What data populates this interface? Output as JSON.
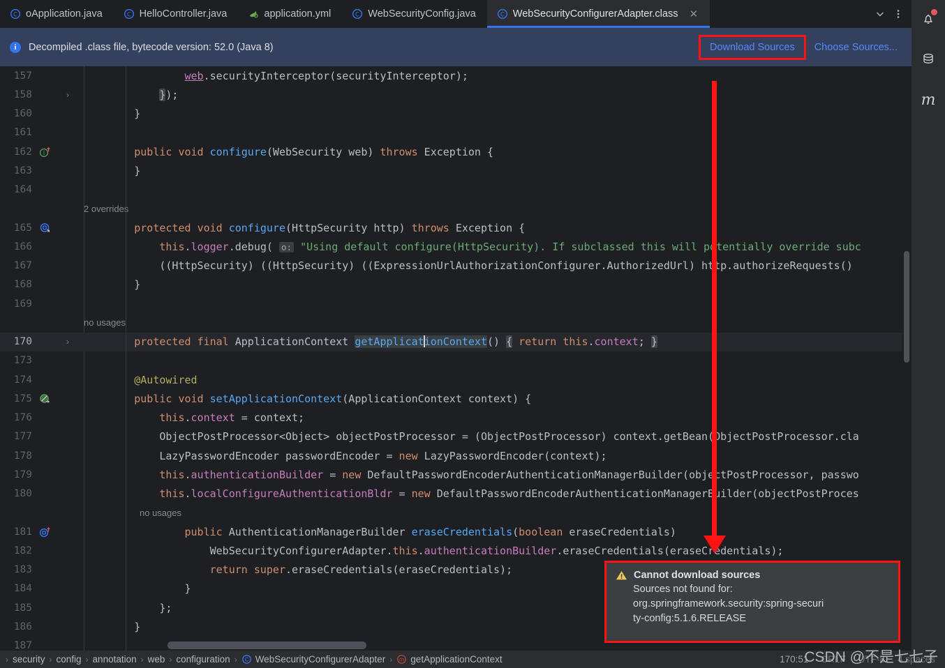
{
  "tabs": [
    {
      "label": "oApplication.java",
      "icon": "java-class-icon",
      "active": false,
      "truncated": true
    },
    {
      "label": "HelloController.java",
      "icon": "java-class-icon",
      "active": false
    },
    {
      "label": "application.yml",
      "icon": "spring-yaml-icon",
      "active": false
    },
    {
      "label": "WebSecurityConfig.java",
      "icon": "java-class-icon",
      "active": false
    },
    {
      "label": "WebSecurityConfigurerAdapter.class",
      "icon": "java-class-icon",
      "active": true,
      "closable": true
    }
  ],
  "tabbar_actions": {
    "dropdown": "⌄",
    "more": "⋮"
  },
  "banner": {
    "message": "Decompiled .class file, bytecode version: 52.0 (Java 8)",
    "info_glyph": "i",
    "actions": [
      {
        "label": "Download Sources",
        "highlighted": true
      },
      {
        "label": "Choose Sources...",
        "highlighted": false
      }
    ]
  },
  "editor": {
    "lines": [
      {
        "num": "157",
        "gutter": "",
        "fold": "",
        "current": false,
        "type": "code"
      },
      {
        "num": "158",
        "gutter": "",
        "fold": "›",
        "current": false,
        "type": "code"
      },
      {
        "num": "160",
        "gutter": "",
        "fold": "",
        "current": false,
        "type": "code"
      },
      {
        "num": "161",
        "gutter": "",
        "fold": "",
        "current": false,
        "type": "code"
      },
      {
        "num": "162",
        "gutter": "implements-override-icon",
        "fold": "",
        "current": false,
        "type": "code"
      },
      {
        "num": "163",
        "gutter": "",
        "fold": "",
        "current": false,
        "type": "code"
      },
      {
        "num": "164",
        "gutter": "",
        "fold": "",
        "current": false,
        "type": "code"
      },
      {
        "num": "",
        "gutter": "",
        "fold": "",
        "current": false,
        "type": "hint",
        "hint": "2 overrides"
      },
      {
        "num": "165",
        "gutter": "overridden-method-icon",
        "fold": "",
        "current": false,
        "type": "code"
      },
      {
        "num": "166",
        "gutter": "",
        "fold": "",
        "current": false,
        "type": "code"
      },
      {
        "num": "167",
        "gutter": "",
        "fold": "",
        "current": false,
        "type": "code"
      },
      {
        "num": "168",
        "gutter": "",
        "fold": "",
        "current": false,
        "type": "code"
      },
      {
        "num": "169",
        "gutter": "",
        "fold": "",
        "current": false,
        "type": "code"
      },
      {
        "num": "",
        "gutter": "",
        "fold": "",
        "current": false,
        "type": "hint",
        "hint": "no usages"
      },
      {
        "num": "170",
        "gutter": "",
        "fold": "›",
        "current": true,
        "type": "code"
      },
      {
        "num": "173",
        "gutter": "",
        "fold": "",
        "current": false,
        "type": "code"
      },
      {
        "num": "174",
        "gutter": "",
        "fold": "",
        "current": false,
        "type": "code"
      },
      {
        "num": "175",
        "gutter": "no-usage-green-icon",
        "fold": "",
        "current": false,
        "type": "code"
      },
      {
        "num": "176",
        "gutter": "",
        "fold": "",
        "current": false,
        "type": "code"
      },
      {
        "num": "177",
        "gutter": "",
        "fold": "",
        "current": false,
        "type": "code"
      },
      {
        "num": "178",
        "gutter": "",
        "fold": "",
        "current": false,
        "type": "code"
      },
      {
        "num": "179",
        "gutter": "",
        "fold": "",
        "current": false,
        "type": "code"
      },
      {
        "num": "180",
        "gutter": "",
        "fold": "",
        "current": false,
        "type": "code"
      },
      {
        "num": "",
        "gutter": "",
        "fold": "",
        "current": false,
        "type": "hint",
        "hint": "no usages"
      },
      {
        "num": "181",
        "gutter": "overriding-method-icon",
        "fold": "",
        "current": false,
        "type": "code"
      },
      {
        "num": "182",
        "gutter": "",
        "fold": "",
        "current": false,
        "type": "code"
      },
      {
        "num": "183",
        "gutter": "",
        "fold": "",
        "current": false,
        "type": "code"
      },
      {
        "num": "184",
        "gutter": "",
        "fold": "",
        "current": false,
        "type": "code"
      },
      {
        "num": "185",
        "gutter": "",
        "fold": "",
        "current": false,
        "type": "code"
      },
      {
        "num": "186",
        "gutter": "",
        "fold": "",
        "current": false,
        "type": "code"
      },
      {
        "num": "187",
        "gutter": "",
        "fold": "",
        "current": false,
        "type": "code"
      }
    ],
    "source_text": {
      "l157": "                web.securityInterceptor(securityInterceptor);",
      "l158": "            });",
      "l160": "        }",
      "l161": "",
      "l162": "        public void configure(WebSecurity web) throws Exception {",
      "l163": "        }",
      "l164": "",
      "l165": "        protected void configure(HttpSecurity http) throws Exception {",
      "l166": "            this.logger.debug( o: \"Using default configure(HttpSecurity). If subclassed this will potentially override subc",
      "l167": "            ((HttpSecurity) ((HttpSecurity) ((ExpressionUrlAuthorizationConfigurer.AuthorizedUrl) http.authorizeRequests()",
      "l168": "        }",
      "l169": "",
      "l170": "        protected final ApplicationContext getApplicationContext() { return this.context; }",
      "l173": "",
      "l174": "        @Autowired",
      "l175": "        public void setApplicationContext(ApplicationContext context) {",
      "l176": "            this.context = context;",
      "l177": "            ObjectPostProcessor<Object> objectPostProcessor = (ObjectPostProcessor) context.getBean(ObjectPostProcessor.cla",
      "l178": "            LazyPasswordEncoder passwordEncoder = new LazyPasswordEncoder(context);",
      "l179": "            this.authenticationBuilder = new DefaultPasswordEncoderAuthenticationManagerBuilder(objectPostProcessor, passwo",
      "l180": "            this.localConfigureAuthenticationBldr = new DefaultPasswordEncoderAuthenticationManagerBuilder(objectPostProces",
      "l181": "                public AuthenticationManagerBuilder eraseCredentials(boolean eraseCredentials)",
      "l182": "                    WebSecurityConfigurerAdapter.this.authenticationBuilder.eraseCredentials(eraseCredentials);",
      "l183": "                    return super.eraseCredentials(eraseCredentials);",
      "l184": "                }",
      "l185": "            };",
      "l186": "        }"
    }
  },
  "tooltip": {
    "title": "Cannot download sources",
    "warning_glyph": "⚠",
    "lines": [
      "Sources not found for:",
      "org.springframework.security:spring-securi",
      "ty-config:5.1.6.RELEASE"
    ]
  },
  "rail": [
    {
      "icon": "notifications-bell-icon",
      "badge": true
    },
    {
      "icon": "database-icon",
      "badge": false
    },
    {
      "icon": "maven-icon",
      "label": "m",
      "badge": false
    }
  ],
  "breadcrumbs": [
    {
      "label": "security",
      "icon": ""
    },
    {
      "label": "config",
      "icon": ""
    },
    {
      "label": "annotation",
      "icon": ""
    },
    {
      "label": "web",
      "icon": ""
    },
    {
      "label": "configuration",
      "icon": ""
    },
    {
      "label": "WebSecurityConfigurerAdapter",
      "icon": "java-class-icon"
    },
    {
      "label": "getApplicationContext",
      "icon": "method-icon"
    }
  ],
  "status": {
    "caret": "170:51",
    "line_separator": "CRLF",
    "encoding": "UTF-8",
    "indent": "4 spaces"
  },
  "watermark": "CSDN @不是七七子",
  "colors": {
    "accent_blue": "#3574f0",
    "link_blue": "#548af7",
    "annotation_red": "#ff1414",
    "banner_bg": "#34415e",
    "editor_bg": "#1e1f22",
    "chrome_bg": "#2b2d30",
    "warning_yellow": "#f2c55c"
  }
}
